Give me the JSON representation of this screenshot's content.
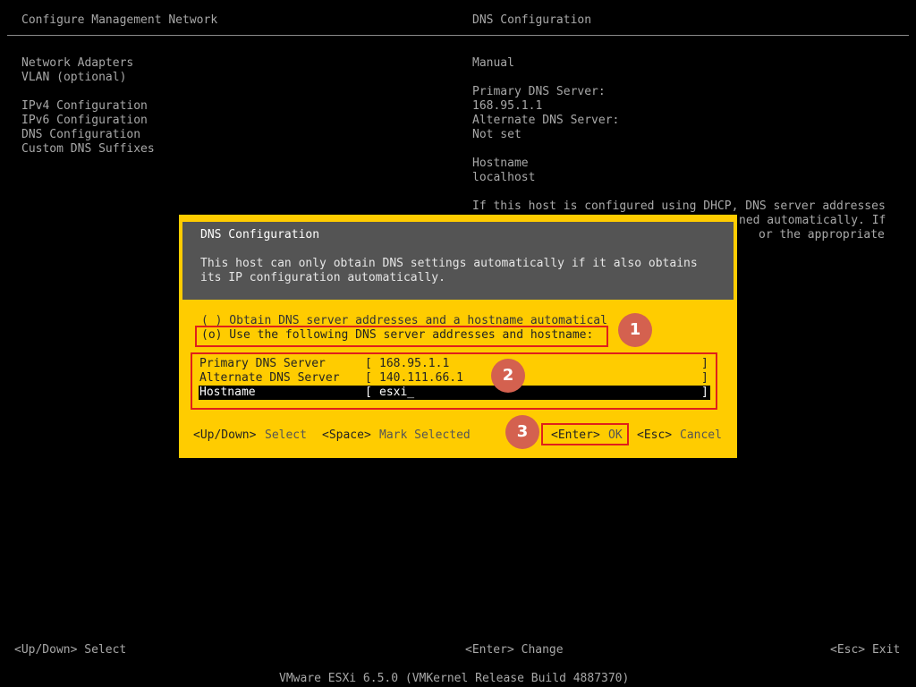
{
  "header": {
    "left_title": "Configure Management Network",
    "right_title": "DNS Configuration"
  },
  "menu": {
    "items": [
      "Network Adapters",
      "VLAN (optional)",
      "IPv4 Configuration",
      "IPv6 Configuration",
      "DNS Configuration",
      "Custom DNS Suffixes"
    ]
  },
  "info": {
    "mode": "Manual",
    "primary_label": "Primary DNS Server:",
    "primary_value": "168.95.1.1",
    "alternate_label": "Alternate DNS Server:",
    "alternate_value": "Not set",
    "hostname_label": "Hostname",
    "hostname_value": "localhost",
    "help_line1": "If this host is configured using DHCP, DNS server addresses",
    "help_line2": "ned automatically. If",
    "help_line3": "or the appropriate"
  },
  "dialog": {
    "title": "DNS Configuration",
    "desc_line1": "This host can only obtain DNS settings automatically if it also obtains",
    "desc_line2": "its IP configuration automatically.",
    "option_auto": "( ) Obtain DNS server addresses and a hostname automatical",
    "option_manual": "(o) Use the following DNS server addresses and hostname:",
    "fields": {
      "primary_label": "Primary DNS Server",
      "primary_value": "168.95.1.1",
      "alternate_label": "Alternate DNS Server",
      "alternate_value": "140.111.66.1",
      "hostname_label": "Hostname",
      "hostname_value": "esxi_"
    },
    "bracket_open": "[",
    "bracket_close": "]",
    "footer": {
      "updown_key": "<Up/Down>",
      "updown_label": "Select",
      "space_key": "<Space>",
      "space_label": "Mark Selected",
      "enter_key": "<Enter>",
      "enter_label": "OK",
      "esc_key": "<Esc>",
      "esc_label": "Cancel"
    }
  },
  "annotations": {
    "badge1": "1",
    "badge2": "2",
    "badge3": "3",
    "color": "#e0201b",
    "badge_color": "#d4614f"
  },
  "bottom_bar": {
    "left": "<Up/Down> Select",
    "center": "<Enter> Change",
    "right": "<Esc> Exit",
    "version": "VMware ESXi 6.5.0 (VMKernel Release Build 4887370)"
  }
}
